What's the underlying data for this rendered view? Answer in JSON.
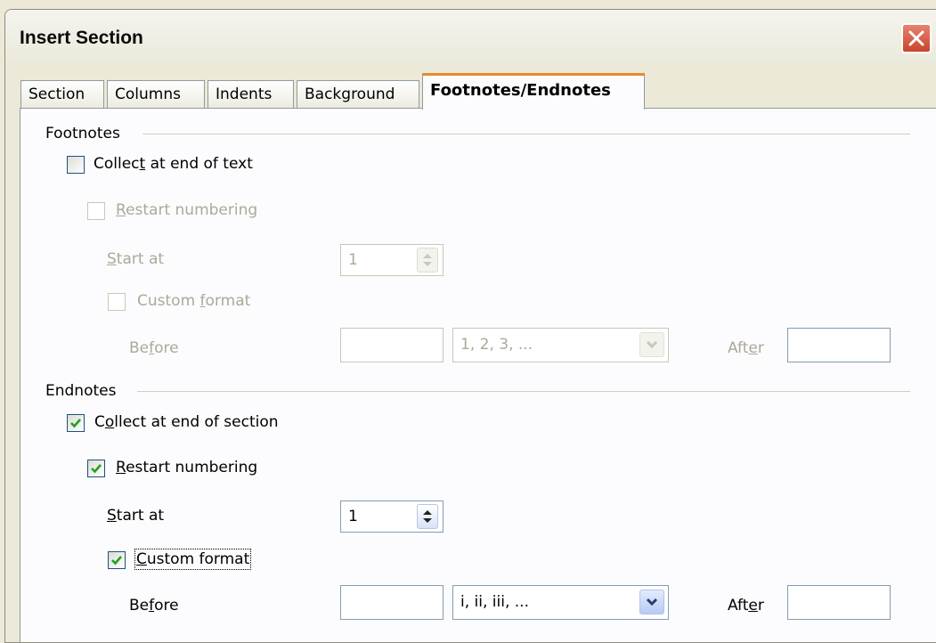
{
  "window": {
    "title": "Insert Section"
  },
  "tabs": [
    {
      "label": "Section"
    },
    {
      "label": "Columns"
    },
    {
      "label": "Indents"
    },
    {
      "label": "Background"
    },
    {
      "label": "Footnotes/Endnotes",
      "active": true
    }
  ],
  "footnotes": {
    "group_label": "Footnotes",
    "collect": {
      "label_pre": "Collec",
      "label_u": "t",
      "label_post": " at end of text",
      "checked": false,
      "enabled": true
    },
    "restart": {
      "label_u": "R",
      "label_post": "estart numbering",
      "checked": false,
      "enabled": false
    },
    "start_at": {
      "label_u": "S",
      "label_post": "tart at",
      "value": "1",
      "enabled": false
    },
    "custom": {
      "label_pre": "Custom ",
      "label_u": "f",
      "label_post": "ormat",
      "checked": false,
      "enabled": false
    },
    "before": {
      "label_pre": "Be",
      "label_u": "f",
      "label_post": "ore",
      "value": ""
    },
    "format": {
      "value": "1, 2, 3, ..."
    },
    "after": {
      "label_pre": "Aft",
      "label_u": "e",
      "label_post": "r",
      "value": ""
    }
  },
  "endnotes": {
    "group_label": "Endnotes",
    "collect": {
      "label_pre": "C",
      "label_u": "o",
      "label_post": "llect at end of section",
      "checked": true,
      "enabled": true
    },
    "restart": {
      "label_u": "R",
      "label_post": "estart numbering",
      "checked": true,
      "enabled": true
    },
    "start_at": {
      "label_u": "S",
      "label_post": "tart at",
      "value": "1",
      "enabled": true
    },
    "custom": {
      "label_u": "C",
      "label_post": "ustom format",
      "checked": true,
      "enabled": true
    },
    "before": {
      "label_pre": "Be",
      "label_u": "f",
      "label_post": "ore",
      "value": ""
    },
    "format": {
      "value": "i, ii, iii, ..."
    },
    "after": {
      "label_pre": "Aft",
      "label_u": "e",
      "label_post": "r",
      "value": ""
    }
  },
  "colors": {
    "tab_accent": "#e68b2c",
    "check": "#21a121",
    "disabled_text": "#aca899"
  },
  "icons": {
    "close": "close-icon",
    "check": "checkmark-icon",
    "spin": "spin-arrows-icon",
    "dropdown": "chevron-down-icon"
  }
}
